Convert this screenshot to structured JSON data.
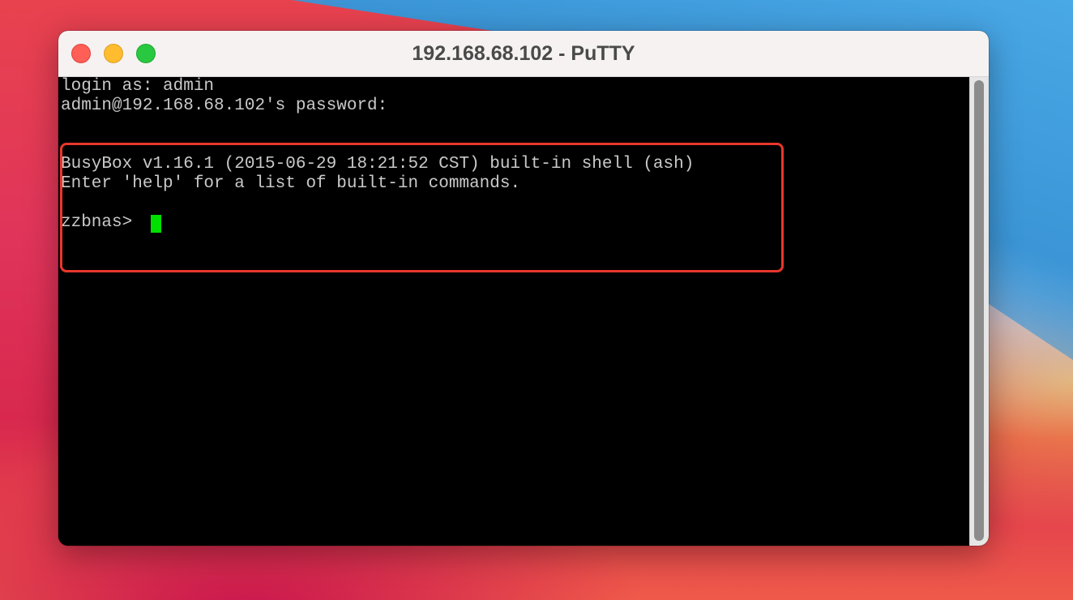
{
  "window": {
    "title": "192.168.68.102 - PuTTY"
  },
  "terminal": {
    "lines": [
      "login as: admin",
      "admin@192.168.68.102's password:",
      "",
      "BusyBox v1.16.1 (2015-06-29 18:21:52 CST) built-in shell (ash)",
      "Enter 'help' for a list of built-in commands.",
      "",
      "zzbnas> "
    ],
    "cursor_color": "#00e000",
    "text_color": "#c9c9c9",
    "background": "#000000"
  },
  "annotation": {
    "color": "#e8372d"
  },
  "icons": [
    "close-button",
    "minimize-button",
    "zoom-button"
  ]
}
